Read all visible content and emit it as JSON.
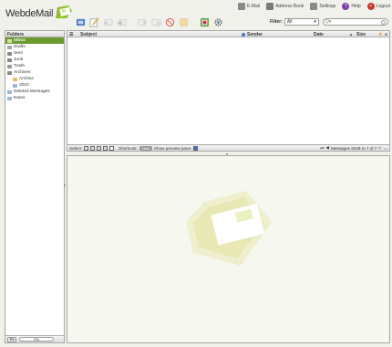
{
  "app": {
    "logo_text": "WebdeMail"
  },
  "toplinks": [
    {
      "label": "E-Mail",
      "icon": "mail-icon",
      "color": "#8a8a8a"
    },
    {
      "label": "Address Book",
      "icon": "address-book-icon",
      "color": "#7a7a7a"
    },
    {
      "label": "Settings",
      "icon": "settings-icon",
      "color": "#8a8a8a"
    },
    {
      "label": "Help",
      "icon": "help-icon",
      "color": "#7d3fa7"
    },
    {
      "label": "Logout",
      "icon": "logout-icon",
      "color": "#c0392b"
    }
  ],
  "filter": {
    "label": "Filter:",
    "value": "All"
  },
  "search": {
    "placeholder": "Q▾"
  },
  "folders": {
    "title": "Folders",
    "items": [
      {
        "label": "Inbox",
        "icon": "inbox-icon",
        "selected": true
      },
      {
        "label": "Drafts",
        "icon": "drafts-icon"
      },
      {
        "label": "Sent",
        "icon": "sent-icon"
      },
      {
        "label": "Junk",
        "icon": "junk-icon"
      },
      {
        "label": "Trash",
        "icon": "trash-icon"
      },
      {
        "label": "Archives",
        "icon": "archives-icon"
      },
      {
        "label": "Archive",
        "icon": "folder-icon",
        "sub": true
      },
      {
        "label": "2010",
        "icon": "folder-icon",
        "sub": true
      },
      {
        "label": "Deleted Messages",
        "icon": "folder-icon"
      },
      {
        "label": "Notes",
        "icon": "folder-icon"
      }
    ],
    "quota": "0%"
  },
  "list": {
    "columns": {
      "subject": "Subject",
      "sender": "Sender",
      "date": "Date",
      "size": "Size"
    }
  },
  "footer": {
    "select_label": "Select:",
    "shortcuts_label": "Shortcuts:",
    "shortcuts_value": "Hide",
    "preview_label": "Show preview pane:",
    "messages_info": "Messages 8449 to 7 of 7"
  },
  "colors": {
    "accent": "#6b9a2e",
    "watermark": "#e3e7a8"
  }
}
